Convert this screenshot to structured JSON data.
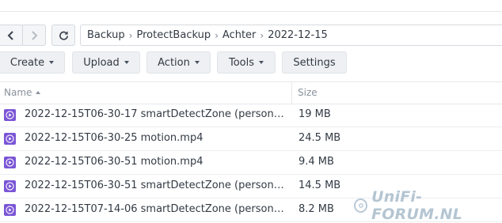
{
  "breadcrumb": [
    "Backup",
    "ProtectBackup",
    "Achter",
    "2022-12-15"
  ],
  "toolbar": {
    "create": "Create",
    "upload": "Upload",
    "action": "Action",
    "tools": "Tools",
    "settings": "Settings"
  },
  "columns": {
    "name": "Name",
    "size": "Size"
  },
  "files": [
    {
      "name": "2022-12-15T06-30-17 smartDetectZone (person).mp4",
      "size": "19 MB"
    },
    {
      "name": "2022-12-15T06-30-25 motion.mp4",
      "size": "24.5 MB"
    },
    {
      "name": "2022-12-15T06-30-51 motion.mp4",
      "size": "9.4 MB"
    },
    {
      "name": "2022-12-15T06-30-51 smartDetectZone (person).mp4",
      "size": "14.5 MB"
    },
    {
      "name": "2022-12-15T07-14-06 smartDetectZone (person).mp4",
      "size": "8.2 MB"
    }
  ],
  "watermark": "UniFi-FORUM.NL",
  "icons": {
    "back": "chevron-left-icon",
    "forward": "chevron-right-icon",
    "refresh": "refresh-icon",
    "file": "video-file-icon"
  },
  "colors": {
    "video_icon": "#7a55d6"
  }
}
